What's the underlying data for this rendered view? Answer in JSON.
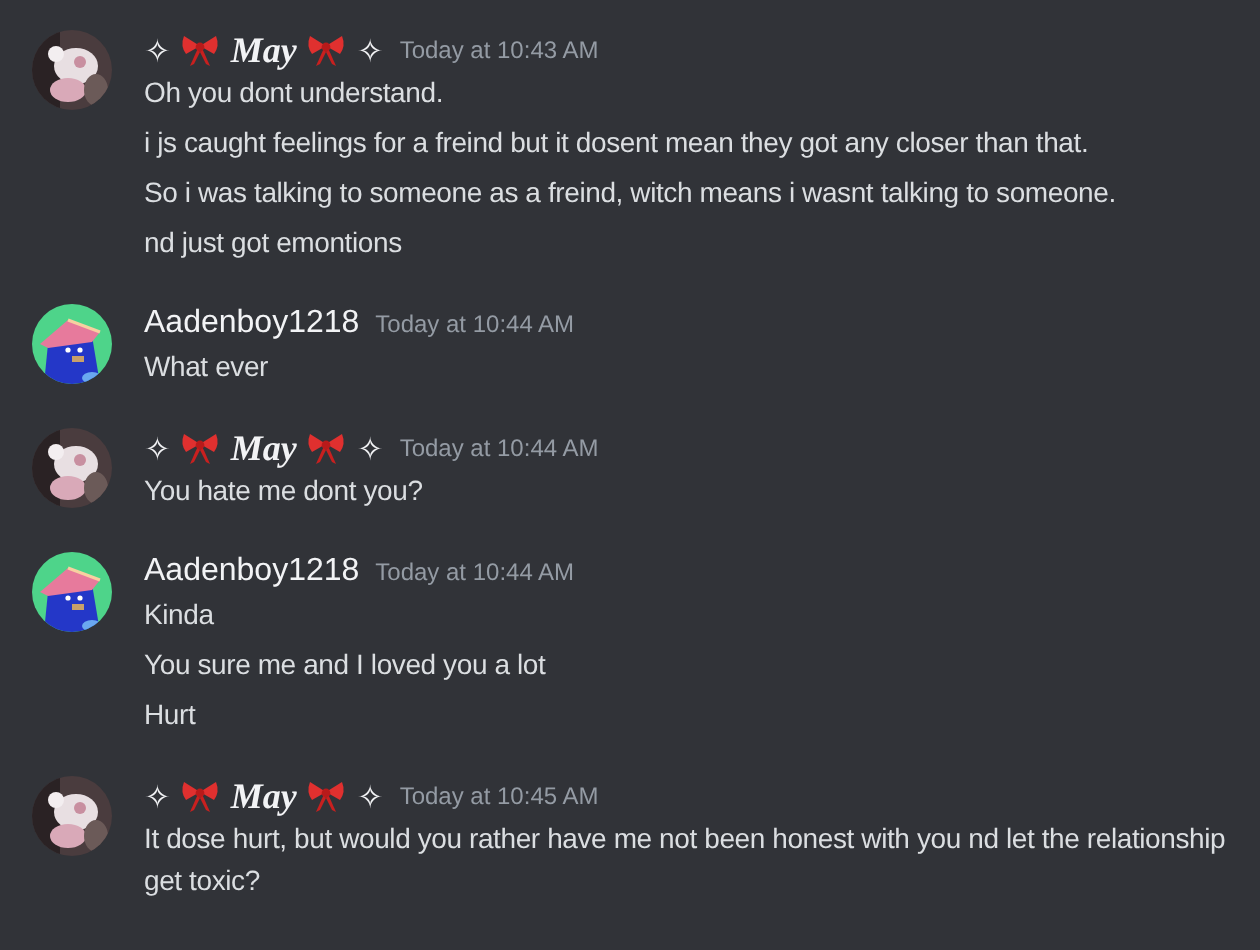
{
  "messages": [
    {
      "author": {
        "kind": "decorated",
        "prefix": "✧",
        "name": "May",
        "suffix": "✧"
      },
      "timestamp": "Today at 10:43 AM",
      "lines": [
        "Oh you dont understand.",
        "i js caught feelings for a freind but it dosent mean they got any closer than that.",
        "So i was talking to someone as a freind, witch means i wasnt talking to someone.",
        "nd just got emontions"
      ]
    },
    {
      "author": {
        "kind": "plain",
        "name": "Aadenboy1218"
      },
      "timestamp": "Today at 10:44 AM",
      "lines": [
        "What ever"
      ]
    },
    {
      "author": {
        "kind": "decorated",
        "prefix": "✧",
        "name": "May",
        "suffix": "✧"
      },
      "timestamp": "Today at 10:44 AM",
      "lines": [
        "You hate me dont you?"
      ]
    },
    {
      "author": {
        "kind": "plain",
        "name": "Aadenboy1218"
      },
      "timestamp": "Today at 10:44 AM",
      "lines": [
        "Kinda",
        "You sure me and I loved you a lot",
        "Hurt"
      ]
    },
    {
      "author": {
        "kind": "decorated",
        "prefix": "✧",
        "name": "May",
        "suffix": "✧"
      },
      "timestamp": "Today at 10:45 AM",
      "lines": [
        "It dose hurt, but would you rather have me not been honest with you nd let the relationship get toxic?"
      ]
    }
  ]
}
